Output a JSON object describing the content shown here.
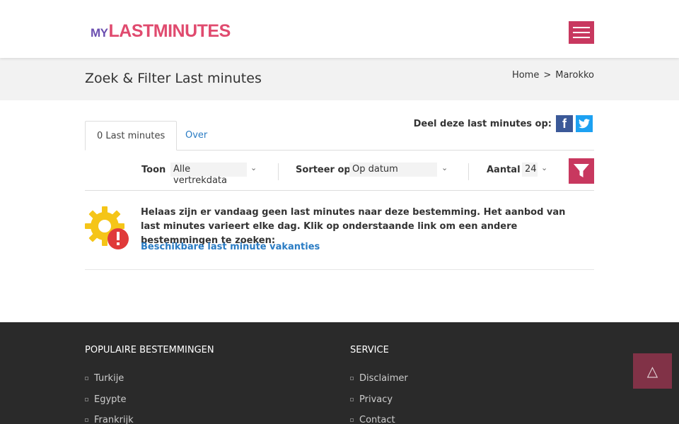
{
  "header": {
    "logo_my": "MY",
    "logo_brand": "LASTMINUTES",
    "menu_icon": "hamburger-icon"
  },
  "title_band": {
    "title": "Zoek & Filter Last minutes",
    "breadcrumb": [
      "Home",
      ">",
      "Marokko"
    ]
  },
  "share": {
    "label": "Deel deze last minutes op:",
    "facebook": "f",
    "twitter": "t"
  },
  "tabs": [
    {
      "label": "0 Last minutes",
      "active": true
    },
    {
      "label": "Over",
      "active": false
    }
  ],
  "filters": {
    "show_label": "Toon",
    "show_value": "Alle vertrekdata",
    "sort_label": "Sorteer op",
    "sort_value": "Op datum",
    "count_label": "Aantal",
    "count_value": "24"
  },
  "notice": {
    "text": "Helaas zijn er vandaag geen last minutes naar deze bestemming. Het aanbod van last minutes varieert elke dag. Klik op onderstaande link om een andere bestemmingen te zoeken:",
    "link": "Beschikbare last minute vakanties"
  },
  "footer": {
    "col1_title": "POPULAIRE BESTEMMINGEN",
    "col1_items": [
      "Turkije",
      "Egypte",
      "Frankrijk"
    ],
    "col2_title": "SERVICE",
    "col2_items": [
      "Disclaimer",
      "Privacy",
      "Contact"
    ]
  },
  "colors": {
    "accent": "#c8385f",
    "link": "#2a7cc4",
    "footer_bg": "#2a2a2a"
  }
}
